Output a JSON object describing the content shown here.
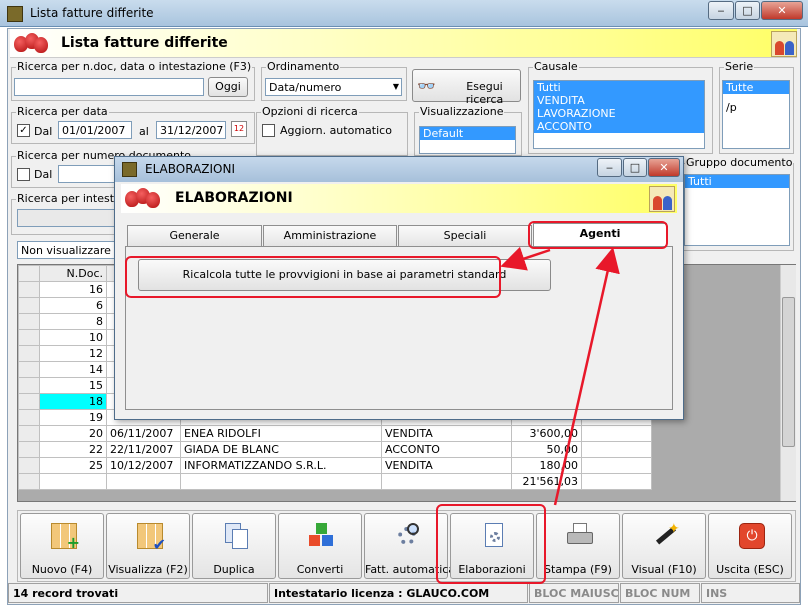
{
  "window": {
    "title": "Lista fatture differite"
  },
  "header": {
    "title": "Lista fatture differite"
  },
  "search": {
    "label": "Ricerca per n.doc, data o intestazione (F3)",
    "value": "",
    "oggi_label": "Oggi"
  },
  "ordinamento": {
    "label": "Ordinamento",
    "value": "Data/numero"
  },
  "esegui_label": "Esegui ricerca",
  "causale": {
    "label": "Causale",
    "items": [
      "Tutti",
      "VENDITA",
      "LAVORAZIONE",
      "ACCONTO"
    ]
  },
  "serie": {
    "label": "Serie",
    "items": [
      "Tutte",
      "/p"
    ]
  },
  "ricerca_data": {
    "label": "Ricerca per data",
    "dal_label": "Dal",
    "dal_value": "01/01/2007",
    "al_label": "al",
    "al_value": "31/12/2007"
  },
  "opzioni": {
    "label": "Opzioni di ricerca",
    "aggiorn_label": "Aggiorn. automatico"
  },
  "visualizzazione": {
    "label": "Visualizzazione",
    "items": [
      "Default"
    ]
  },
  "ricerca_numero": {
    "label": "Ricerca per numero documento",
    "dal_label": "Dal"
  },
  "ricerca_intestatario": {
    "label": "Ricerca per intestat"
  },
  "gruppo": {
    "label": "Gruppo documento",
    "items": [
      "Tutti"
    ]
  },
  "filter_combo": {
    "value": "Non visualizzare de"
  },
  "grid": {
    "header": [
      "N.Doc."
    ],
    "rows": [
      {
        "num": "16",
        "date": "",
        "name": "",
        "causale": "",
        "amount": ""
      },
      {
        "num": "6",
        "date": "",
        "name": "",
        "causale": "",
        "amount": ""
      },
      {
        "num": "8",
        "date": "",
        "name": "",
        "causale": "",
        "amount": ""
      },
      {
        "num": "10",
        "date": "",
        "name": "",
        "causale": "",
        "amount": ""
      },
      {
        "num": "12",
        "date": "",
        "name": "",
        "causale": "",
        "amount": ""
      },
      {
        "num": "14",
        "date": "",
        "name": "",
        "causale": "",
        "amount": ""
      },
      {
        "num": "15",
        "date": "",
        "name": "",
        "causale": "",
        "amount": ""
      },
      {
        "num": "18",
        "date": "",
        "name": "",
        "causale": "",
        "amount": ""
      },
      {
        "num": "19",
        "date": "",
        "name": "",
        "causale": "",
        "amount": ""
      },
      {
        "num": "20",
        "date": "06/11/2007",
        "name": "ENEA RIDOLFI",
        "causale": "VENDITA",
        "amount": "3'600,00"
      },
      {
        "num": "22",
        "date": "22/11/2007",
        "name": "GIADA DE BLANC",
        "causale": "ACCONTO",
        "amount": "50,00"
      },
      {
        "num": "25",
        "date": "10/12/2007",
        "name": "INFORMATIZZANDO S.R.L.",
        "causale": "VENDITA",
        "amount": "180,00"
      },
      {
        "num": "",
        "date": "",
        "name": "",
        "causale": "",
        "amount": "21'561,03"
      }
    ]
  },
  "toolbar": {
    "nuovo": "Nuovo (F4)",
    "visualizza": "Visualizza (F2)",
    "duplica": "Duplica",
    "converti": "Converti",
    "fatt_auto": "Fatt. automatica",
    "elaborazioni": "Elaborazioni",
    "stampa": "Stampa (F9)",
    "visual": "Visual (F10)",
    "uscita": "Uscita (ESC)"
  },
  "statusbar": {
    "records": "14 record trovati",
    "licenza": "Intestatario licenza : GLAUCO.COM",
    "maiusc": "BLOC MAIUSC",
    "num": "BLOC NUM",
    "ins": "INS"
  },
  "dialog": {
    "title": "ELABORAZIONI",
    "header": "ELABORAZIONI",
    "tabs": [
      "Generale",
      "Amministrazione",
      "Speciali",
      "Agenti"
    ],
    "ricalcola_label": "Ricalcola tutte le provvigioni in base ai parametri standard"
  },
  "colors": {
    "selection": "#3399ff",
    "highlight_row": "#00ffff",
    "annotation": "#e8182a"
  }
}
